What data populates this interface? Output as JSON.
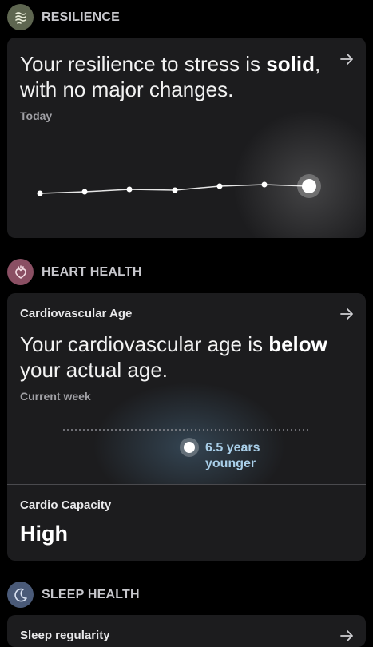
{
  "resilience": {
    "title": "RESILIENCE",
    "icon": "waves-icon",
    "icon_bg": "#5e6650",
    "headline_pre": "Your resilience to stress is ",
    "headline_bold": "solid",
    "headline_post": ", with no major changes.",
    "period": "Today"
  },
  "heart": {
    "title": "HEART HEALTH",
    "icon": "heart-icon",
    "icon_bg": "#8a4f63",
    "card_label": "Cardiovascular Age",
    "headline_pre": "Your cardiovascular age is ",
    "headline_bold": "below",
    "headline_post": " your actual age.",
    "period": "Current week",
    "marker_line1": "6.5 years",
    "marker_line2": "younger",
    "capacity_label": "Cardio Capacity",
    "capacity_value": "High"
  },
  "sleep": {
    "title": "SLEEP HEALTH",
    "icon": "moon-icon",
    "icon_bg": "#4a5a78",
    "card_label": "Sleep regularity"
  },
  "colors": {
    "card_bg": "#1c1c1e",
    "accent_blue": "#a9cfe9"
  }
}
